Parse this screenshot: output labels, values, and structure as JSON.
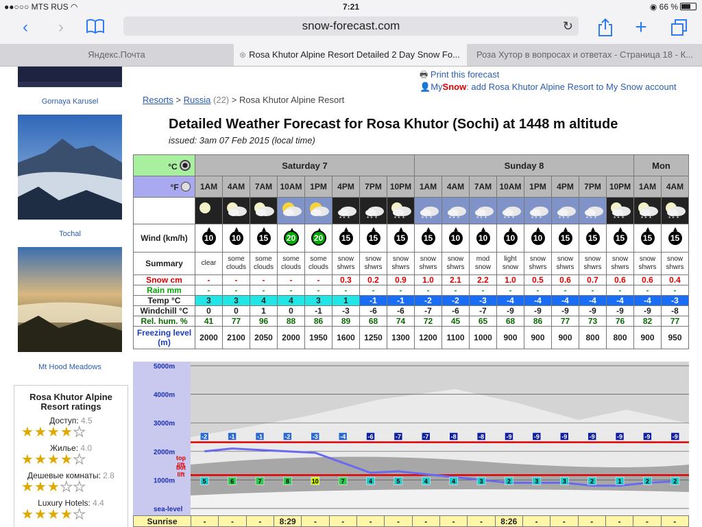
{
  "status": {
    "carrier": "MTS RUS",
    "time": "7:21",
    "battery": "66 %",
    "battery_level": 0.66
  },
  "browser": {
    "url": "snow-forecast.com",
    "tabs": [
      {
        "label": "Яндекс.Почта",
        "active": false
      },
      {
        "label": "Rosa Khutor Alpine Resort Detailed 2 Day Snow Fo...",
        "active": true
      },
      {
        "label": "Роза Хутор в вопросах и ответах - Страница 18 - К...",
        "active": false
      }
    ]
  },
  "sidebar": {
    "captions": [
      "Gornaya Karusel",
      "Tochal",
      "Mt Hood Meadows"
    ],
    "ratings_title": "Rosa Khutor Alpine Resort ratings",
    "ratings": [
      {
        "label": "Доступ:",
        "value": "4.5",
        "stars": 4.5
      },
      {
        "label": "Жилье:",
        "value": "4.0",
        "stars": 4
      },
      {
        "label": "Дешевые комнаты:",
        "value": "2.8",
        "stars": 3
      },
      {
        "label": "Luxury Hotels:",
        "value": "4.4",
        "stars": 4.5
      }
    ]
  },
  "links": {
    "print": "Print this forecast",
    "mysnow_prefix": "My",
    "mysnow_brand": "Snow",
    "mysnow_rest": ": add Rosa Khutor Alpine Resort to My Snow account"
  },
  "breadcrumb": {
    "resorts": "Resorts",
    "sep1": ">",
    "russia": "Russia",
    "count": "(22)",
    "sep2": ">",
    "current": "Rosa Khutor Alpine Resort"
  },
  "title": "Detailed Weather Forecast for Rosa Khutor (Sochi) at 1448 m altitude",
  "issued": "issued: 3am 07 Feb 2015 (local time)",
  "units": {
    "c": "°C",
    "f": "°F"
  },
  "days": [
    "Saturday 7",
    "Sunday 8",
    "Mon"
  ],
  "hours": [
    "1AM",
    "4AM",
    "7AM",
    "10AM",
    "1PM",
    "4PM",
    "7PM",
    "10PM",
    "1AM",
    "4AM",
    "7AM",
    "10AM",
    "1PM",
    "4PM",
    "7PM",
    "10PM",
    "1AM",
    "4AM"
  ],
  "row_labels": {
    "wind": "Wind (km/h)",
    "summary": "Summary",
    "snow": "Snow cm",
    "rain": "Rain mm",
    "temp": "Temp °C",
    "windchill": "Windchill °C",
    "hum": "Rel. hum. %",
    "freezing": "Freezing level (m)",
    "sunrise": "Sunrise"
  },
  "wx_icons": [
    "moon-icon",
    "moon-cloud-icon",
    "moon-cloud-icon",
    "sun-cloud-icon",
    "sun-cloud-icon",
    "snow-shower-icon",
    "snow-shower-icon",
    "moon-snow-icon",
    "snow-shower-icon",
    "snow-shower-icon",
    "cloud-snow-icon",
    "cloud-snow-icon",
    "snow-shower-icon",
    "snow-shower-icon",
    "snow-shower-icon",
    "moon-snow-icon",
    "moon-snow-icon",
    "moon-snow-icon"
  ],
  "wind": [
    10,
    10,
    15,
    20,
    20,
    15,
    15,
    15,
    15,
    10,
    10,
    10,
    10,
    15,
    15,
    15,
    15,
    15
  ],
  "wind_green": [
    false,
    false,
    false,
    true,
    true,
    false,
    false,
    false,
    false,
    false,
    false,
    false,
    false,
    false,
    false,
    false,
    false,
    false
  ],
  "summary": [
    [
      "clear"
    ],
    [
      "some",
      "clouds"
    ],
    [
      "some",
      "clouds"
    ],
    [
      "some",
      "clouds"
    ],
    [
      "some",
      "clouds"
    ],
    [
      "snow",
      "shwrs"
    ],
    [
      "snow",
      "shwrs"
    ],
    [
      "snow",
      "shwrs"
    ],
    [
      "snow",
      "shwrs"
    ],
    [
      "snow",
      "shwrs"
    ],
    [
      "mod",
      "snow"
    ],
    [
      "light",
      "snow"
    ],
    [
      "snow",
      "shwrs"
    ],
    [
      "snow",
      "shwrs"
    ],
    [
      "snow",
      "shwrs"
    ],
    [
      "snow",
      "shwrs"
    ],
    [
      "snow",
      "shwrs"
    ],
    [
      "snow",
      "shwrs"
    ]
  ],
  "snow": [
    "-",
    "-",
    "-",
    "-",
    "-",
    "0.3",
    "0.2",
    "0.9",
    "1.0",
    "2.1",
    "2.2",
    "1.0",
    "0.5",
    "0.6",
    "0.7",
    "0.6",
    "0.6",
    "0.4"
  ],
  "rain": [
    "-",
    "-",
    "-",
    "-",
    "-",
    "-",
    "-",
    "-",
    "-",
    "-",
    "-",
    "-",
    "-",
    "-",
    "-",
    "-",
    "-",
    "-"
  ],
  "temp": [
    3,
    3,
    4,
    4,
    3,
    1,
    -1,
    -1,
    -2,
    -2,
    -3,
    -4,
    -4,
    -4,
    -4,
    -4,
    -4,
    -3
  ],
  "windchill": [
    0,
    0,
    1,
    0,
    -1,
    -3,
    -6,
    -6,
    -7,
    -6,
    -7,
    -9,
    -9,
    -9,
    -9,
    -9,
    -9,
    -8
  ],
  "hum": [
    41,
    77,
    96,
    88,
    86,
    89,
    68,
    74,
    72,
    45,
    65,
    68,
    86,
    77,
    73,
    76,
    82,
    77
  ],
  "freezing": [
    2000,
    2100,
    2050,
    2000,
    1950,
    1600,
    1250,
    1300,
    1200,
    1100,
    1000,
    900,
    900,
    900,
    800,
    800,
    900,
    950
  ],
  "sunrise": [
    "-",
    "-",
    "-",
    "8:29",
    "-",
    "-",
    "-",
    "-",
    "-",
    "-",
    "-",
    "8:26",
    "-",
    "-",
    "-",
    "-",
    "-",
    "-"
  ],
  "chart": {
    "ylabels": [
      "5000m",
      "4000m",
      "3000m",
      "2000m",
      "1000m",
      "sea-level"
    ],
    "top_lift_label": "top lift",
    "bot_lift_label": "bot lift",
    "top_temps": [
      -2,
      -1,
      -1,
      -2,
      -3,
      -4,
      -6,
      -7,
      -7,
      -8,
      -8,
      -9,
      -9,
      -9,
      -9,
      -9,
      -9,
      -9
    ],
    "bot_temps": [
      5,
      6,
      7,
      8,
      10,
      7,
      4,
      5,
      4,
      4,
      3,
      2,
      3,
      3,
      2,
      1,
      2,
      2
    ],
    "top_lift_altitude": 2320,
    "bot_lift_altitude": 1170
  },
  "colors": {
    "celsius_bg": "#a8f0a0",
    "fahrenheit_bg": "#a9a9f0",
    "temp_warm": "#22e6e6",
    "temp_cold": "#1a6ef5",
    "freeze_line": "#6a6af0",
    "lift_line": "#e00000"
  }
}
